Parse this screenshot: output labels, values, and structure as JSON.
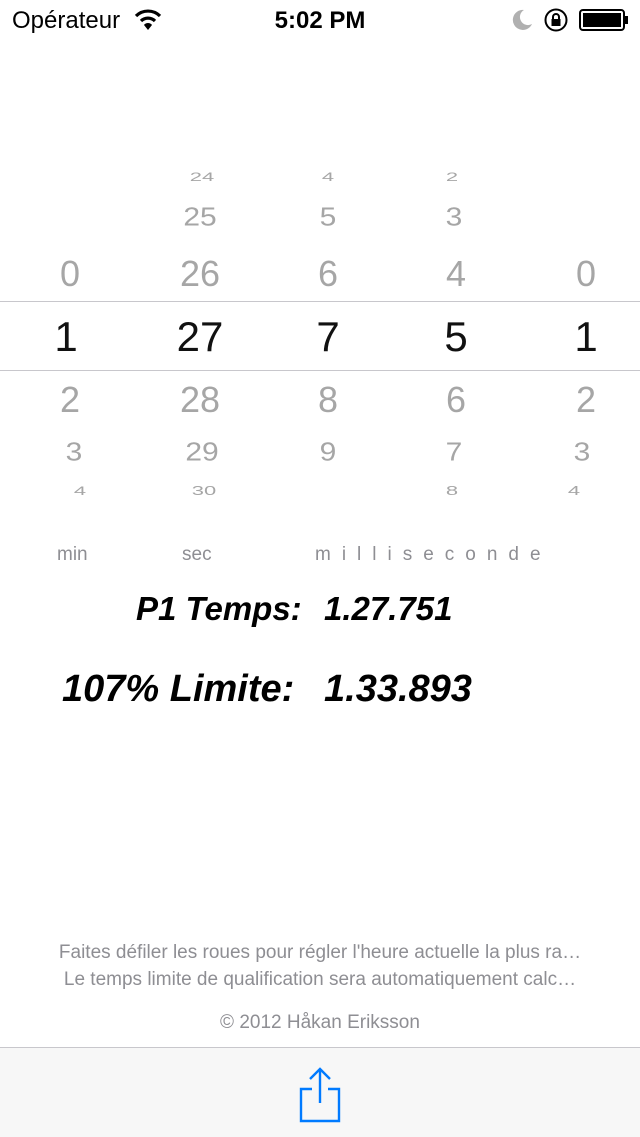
{
  "status_bar": {
    "carrier": "Opérateur",
    "time": "5:02 PM"
  },
  "picker": {
    "columns": [
      {
        "id": "minutes",
        "above": [
          "",
          "",
          "0"
        ],
        "selected": "1",
        "below": [
          "2",
          "3",
          "4"
        ]
      },
      {
        "id": "seconds",
        "above": [
          "24",
          "25",
          "26"
        ],
        "selected": "27",
        "below": [
          "28",
          "29",
          "30"
        ]
      },
      {
        "id": "ms-hundreds",
        "above": [
          "4",
          "5",
          "6"
        ],
        "selected": "7",
        "below": [
          "8",
          "9",
          ""
        ]
      },
      {
        "id": "ms-tens",
        "above": [
          "2",
          "3",
          "4"
        ],
        "selected": "5",
        "below": [
          "6",
          "7",
          "8"
        ]
      },
      {
        "id": "ms-units",
        "above": [
          "",
          "",
          "0"
        ],
        "selected": "1",
        "below": [
          "2",
          "3",
          "4"
        ]
      }
    ]
  },
  "labels": {
    "min": "min",
    "sec": "sec",
    "millisecond": "milliseconde"
  },
  "results": {
    "p1_label": "P1 Temps:",
    "p1_value": "1.27.751",
    "limit_label": "107% Limite:",
    "limit_value": "1.33.893"
  },
  "footer": {
    "instruction_1": "Faites défiler les roues pour régler l'heure actuelle la plus ra…",
    "instruction_2": "Le temps limite de qualification sera automatiquement calc…",
    "copyright": "© 2012 Håkan Eriksson"
  },
  "toolbar": {
    "share_icon": "share-icon"
  },
  "colors": {
    "accent": "#007aff",
    "selected_text": "#111111",
    "dim_text": "#a6a6a6",
    "label_text": "#8e8e93"
  }
}
